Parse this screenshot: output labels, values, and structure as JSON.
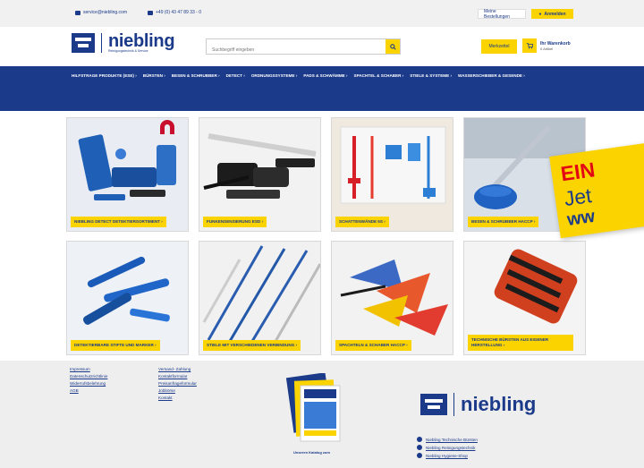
{
  "topbar": {
    "email": "service@niebling.com",
    "phone": "+49 (0) 43 47 89 33 - 0",
    "orders_label": "Meine Bestellungen",
    "login_label": "Anmelden"
  },
  "header": {
    "brand": "niebling",
    "tagline": "Reinigungstechnik & Service",
    "search_placeholder": "Suchbegriff eingeben",
    "wishlist_label": "Merkzettel",
    "cart_title": "Ihr Warenkorb",
    "cart_sub": "0 Artikel"
  },
  "nav": {
    "items": [
      "HILFSTRAGE PRODUKTE (ESE) ›",
      "BÜRSTEN ›",
      "BESEN & SCHRUBBER ›",
      "DETECT ›",
      "ORDNUNGSSYSTEME ›",
      "PADS & SCHWÄMME ›",
      "SPACHTEL & SCHABER ›",
      "STIELE & SYSTEME ›",
      "WASSERSCHIEBER & GESENDE ›"
    ]
  },
  "tiles": [
    "NIEBLING DETECT DETEKTIERSORTIMENT ›",
    "FUNKENSENSIERUNG ESD ›",
    "SCHATTENWÄNDE 5S ›",
    "BESEN & SCHRUBBER HACCP ›",
    "DETEKTIERBARE STIFTE UND MARKER ›",
    "STIELE MIT VERSCHIEDENEN VERBINDUNG ›",
    "SPACHTELN & SCHABER HACCP ›",
    "TECHNISCHE BÜRSTEN AUS EIGENER HERSTELLUNG ›"
  ],
  "promo": {
    "line1": "EIN",
    "line2": "Jet",
    "line3": "ww"
  },
  "footer": {
    "col1": [
      "Impressum",
      "Datenschutzrichtlinie",
      "Widerrufsbelehrung",
      "AGB"
    ],
    "col2": [
      "Versand- Zahlung",
      "Kontaktformular",
      "Preisanfrageformular",
      "Jobbörse",
      "Kontakt"
    ],
    "catalog_caption": "Unseren Katalog zum",
    "brand": "niebling",
    "links": [
      "Niebling Technische Bürsten",
      "Niebling Reinigungstechnik",
      "Niebling Hygiene-Shop"
    ]
  }
}
